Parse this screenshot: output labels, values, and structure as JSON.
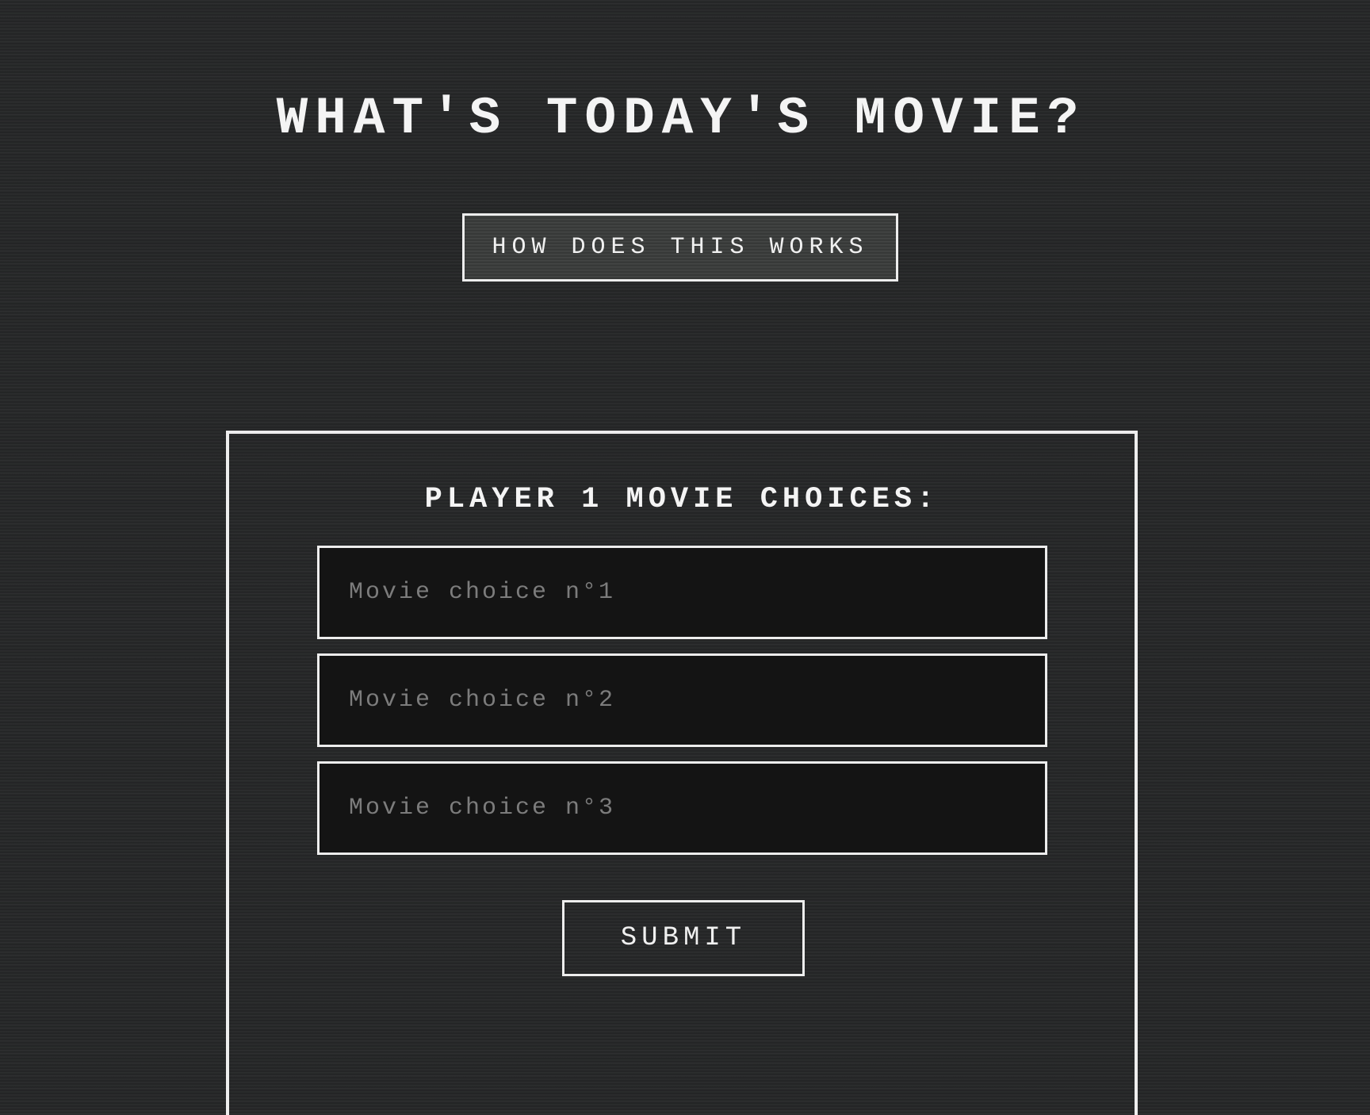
{
  "header": {
    "title": "WHAT'S TODAY'S MOVIE?",
    "how_button_label": "HOW DOES THIS WORKS"
  },
  "player_form": {
    "title": "PLAYER 1 MOVIE CHOICES:",
    "inputs": [
      {
        "placeholder": "Movie choice n°1",
        "value": ""
      },
      {
        "placeholder": "Movie choice n°2",
        "value": ""
      },
      {
        "placeholder": "Movie choice n°3",
        "value": ""
      }
    ],
    "submit_label": "SUBMIT"
  },
  "colors": {
    "background": "#262728",
    "text": "#f2f2f2",
    "border": "#ededed",
    "input_background": "#141414",
    "placeholder": "#7c7c7c"
  }
}
